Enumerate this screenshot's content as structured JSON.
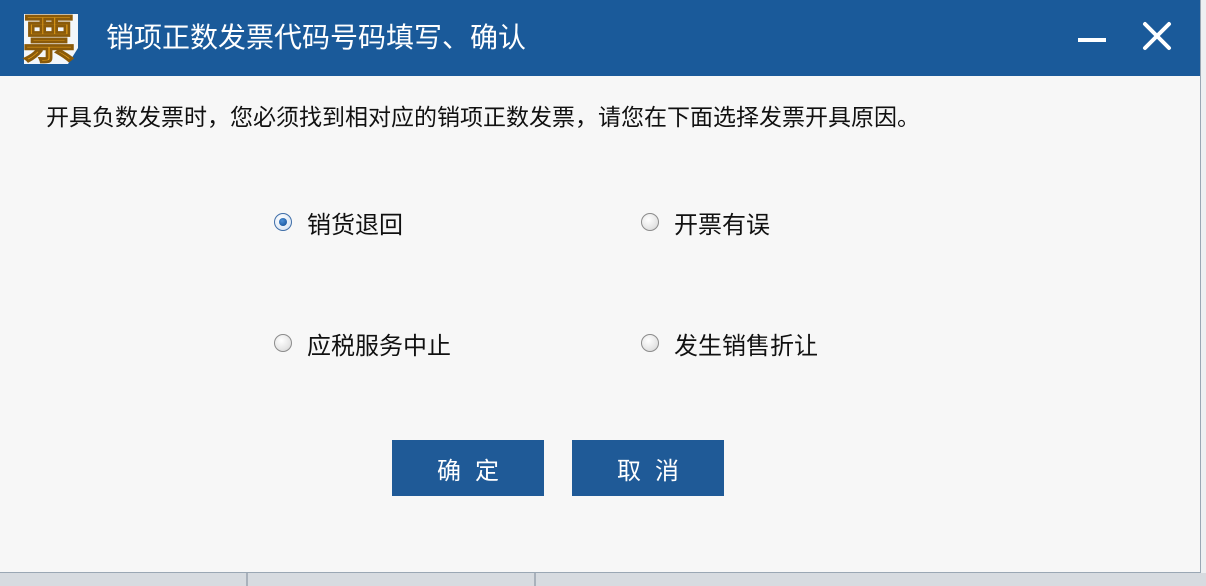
{
  "window": {
    "title": "销项正数发票代码号码填写、确认",
    "app_icon": "piao-icon",
    "app_icon_glyph": "票",
    "minimize_icon": "minimize-icon",
    "close_icon": "close-icon"
  },
  "prompt": "开具负数发票时，您必须找到相对应的销项正数发票，请您在下面选择发票开具原因。",
  "reasons": [
    {
      "label": "销货退回",
      "checked": true
    },
    {
      "label": "开票有误",
      "checked": false
    },
    {
      "label": "应税服务中止",
      "checked": false
    },
    {
      "label": "发生销售折让",
      "checked": false
    }
  ],
  "buttons": {
    "ok": "确定",
    "cancel": "取消"
  },
  "colors": {
    "title_bar": "#1a5a9a",
    "button": "#1f5a97",
    "icon_gold": "#f2a91c"
  }
}
